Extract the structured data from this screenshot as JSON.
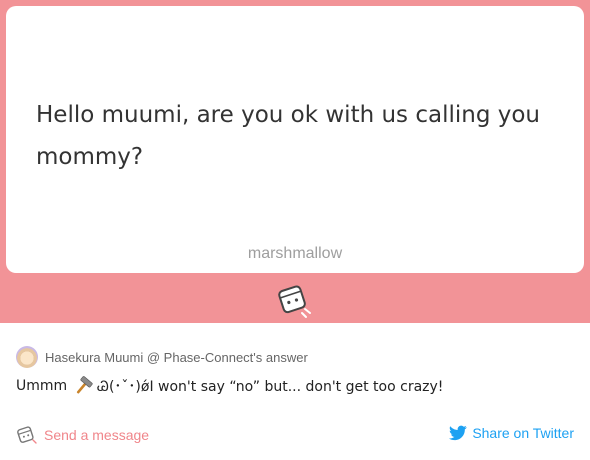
{
  "question": {
    "text": "Hello muumi, are you ok with us calling you mommy?",
    "brand_label": "marshmallow"
  },
  "answer": {
    "answered_by": "Hasekura Muumi @ Phase-Connect's answer",
    "text_before_icon": "Ummm",
    "text_after_icon": "Ꮚ(･ˇ･)ǿI won't say “no” but... don't get too crazy!"
  },
  "actions": {
    "send_message_label": "Send a message",
    "share_twitter_label": "Share on Twitter"
  },
  "colors": {
    "band": "#f29397",
    "send_message": "#f0868b",
    "twitter": "#1da1f2"
  },
  "icons": [
    "marshmallow-mascot-icon",
    "hammer-icon",
    "avatar",
    "twitter-bird-icon"
  ]
}
